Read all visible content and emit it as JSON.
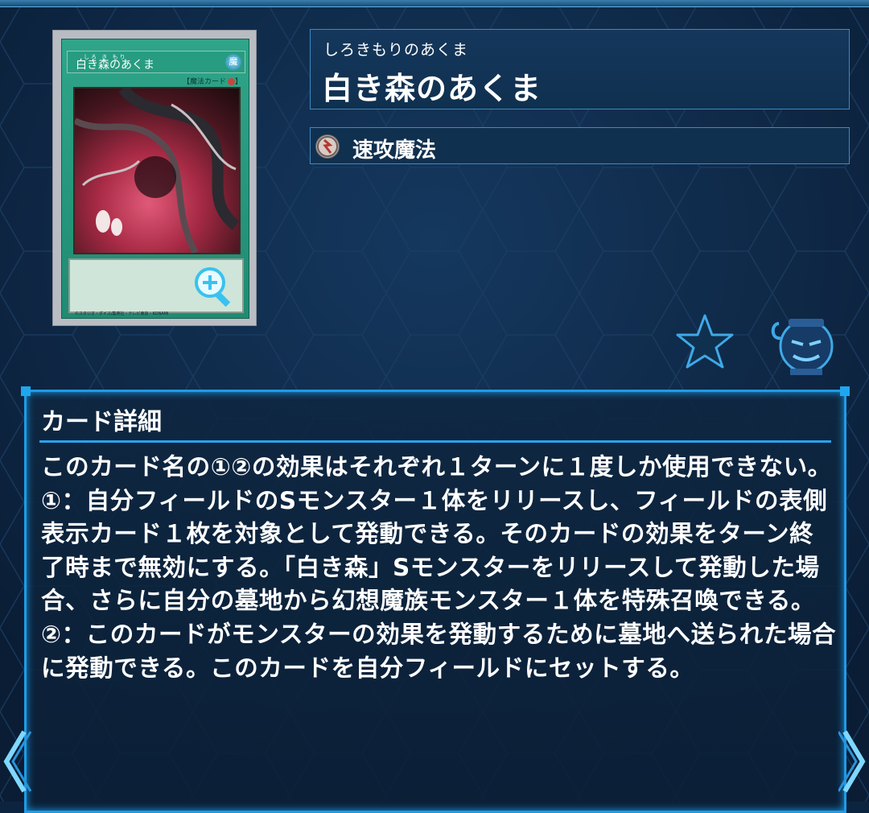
{
  "card": {
    "ruby": "しろ き もり",
    "name": "白き森のあくま",
    "attribute": "魔",
    "type_line": "【魔法カード",
    "copyright": "©スタジオ・ダイス/集英社・テレビ東京・KONAMI",
    "frame_color": "#27a081",
    "zoom_icon": "zoom-in-icon"
  },
  "header": {
    "ruby": "しろきもりのあくま",
    "title": "白き森のあくま",
    "type_label": "速攻魔法",
    "type_icon": "quick-play-spell-icon"
  },
  "actions": {
    "favorite_icon": "star-icon",
    "mascot_icon": "pot-of-greed-mascot-icon"
  },
  "detail": {
    "heading": "カード詳細",
    "effect_text": "このカード名の①②の効果はそれぞれ１ターンに１度しか使用できない。\n①：自分フィールドのSモンスター１体をリリースし、フィールドの表側表示カード１枚を対象として発動できる。そのカードの効果をターン終了時まで無効にする。「白き森」Sモンスターをリリースして発動した場合、さらに自分の墓地から幻想魔族モンスター１体を特殊召喚できる。\n②：このカードがモンスターの効果を発動するために墓地へ送られた場合に発動できる。このカードを自分フィールドにセットする。"
  },
  "nav": {
    "prev_icon": "chevron-left-icon",
    "next_icon": "chevron-right-icon"
  },
  "colors": {
    "background": "#0d2440",
    "panel_border": "#3c8ac2",
    "accent": "#1f9be6",
    "text": "#ffffff"
  }
}
